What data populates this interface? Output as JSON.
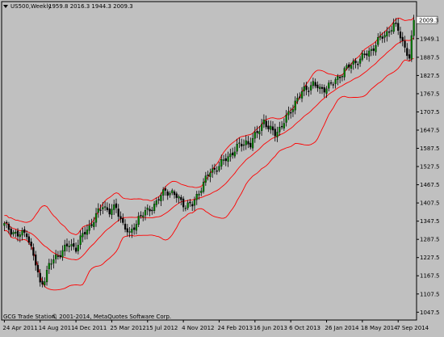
{
  "header": {
    "symbol": "US500,Weekly",
    "ohlc": "1959.8 2016.3 1944.3 2009.3"
  },
  "footer_text": "© 2001-2014, MetaQuotes Software Corp.",
  "footer_prefix": "GCG Trade Station,",
  "price_badge": "2009.3",
  "colors": {
    "background": "#c0c0c0",
    "axis_text": "#000000",
    "bull_candle": "#008000",
    "bear_candle": "#000000",
    "bands": "#ff0000",
    "badge_bg": "#ffffff"
  },
  "chart_data": {
    "type": "candlestick",
    "title": "",
    "timeframe": "Weekly",
    "y_ticks": [
      "2009.3",
      "1949.1",
      "1887.5",
      "1827.5",
      "1767.5",
      "1707.5",
      "1647.5",
      "1587.5",
      "1527.5",
      "1467.5",
      "1407.5",
      "1347.5",
      "1287.5",
      "1227.5",
      "1167.5",
      "1107.5",
      "1047.5"
    ],
    "y_tick_values": [
      2009.3,
      1949.1,
      1887.5,
      1827.5,
      1767.5,
      1707.5,
      1647.5,
      1587.5,
      1527.5,
      1467.5,
      1407.5,
      1347.5,
      1287.5,
      1227.5,
      1167.5,
      1107.5,
      1047.5
    ],
    "ylim": [
      1027,
      2039
    ],
    "x_ticks": [
      "24 Apr 2011",
      "14 Aug 2011",
      "4 Dec 2011",
      "25 Mar 2012",
      "15 Jul 2012",
      "4 Nov 2012",
      "24 Feb 2013",
      "16 Jun 2013",
      "6 Oct 2013",
      "26 Jan 2014",
      "18 May 2014",
      "7 Sep 2014"
    ],
    "x_tick_index": [
      0,
      16,
      32,
      48,
      64,
      80,
      96,
      112,
      128,
      144,
      160,
      176
    ],
    "bar_count": 184,
    "bands": "Bollinger Bands",
    "close_anchors": [
      [
        0,
        1335
      ],
      [
        6,
        1300
      ],
      [
        10,
        1310
      ],
      [
        14,
        1205
      ],
      [
        16,
        1140
      ],
      [
        18,
        1160
      ],
      [
        20,
        1200
      ],
      [
        23,
        1230
      ],
      [
        26,
        1250
      ],
      [
        29,
        1270
      ],
      [
        32,
        1260
      ],
      [
        35,
        1300
      ],
      [
        39,
        1340
      ],
      [
        44,
        1400
      ],
      [
        47,
        1380
      ],
      [
        50,
        1390
      ],
      [
        53,
        1340
      ],
      [
        56,
        1300
      ],
      [
        60,
        1360
      ],
      [
        64,
        1380
      ],
      [
        68,
        1410
      ],
      [
        72,
        1450
      ],
      [
        75,
        1440
      ],
      [
        78,
        1420
      ],
      [
        81,
        1400
      ],
      [
        84,
        1400
      ],
      [
        88,
        1460
      ],
      [
        92,
        1510
      ],
      [
        96,
        1530
      ],
      [
        100,
        1560
      ],
      [
        104,
        1590
      ],
      [
        108,
        1610
      ],
      [
        110,
        1600
      ],
      [
        113,
        1640
      ],
      [
        116,
        1680
      ],
      [
        118,
        1650
      ],
      [
        121,
        1640
      ],
      [
        124,
        1660
      ],
      [
        127,
        1700
      ],
      [
        130,
        1740
      ],
      [
        134,
        1780
      ],
      [
        138,
        1800
      ],
      [
        141,
        1780
      ],
      [
        144,
        1790
      ],
      [
        147,
        1800
      ],
      [
        150,
        1830
      ],
      [
        153,
        1850
      ],
      [
        156,
        1870
      ],
      [
        159,
        1880
      ],
      [
        162,
        1900
      ],
      [
        165,
        1920
      ],
      [
        168,
        1950
      ],
      [
        171,
        1970
      ],
      [
        174,
        1990
      ],
      [
        176,
        1980
      ],
      [
        179,
        1920
      ],
      [
        181,
        1880
      ],
      [
        183,
        2009.3
      ]
    ]
  }
}
